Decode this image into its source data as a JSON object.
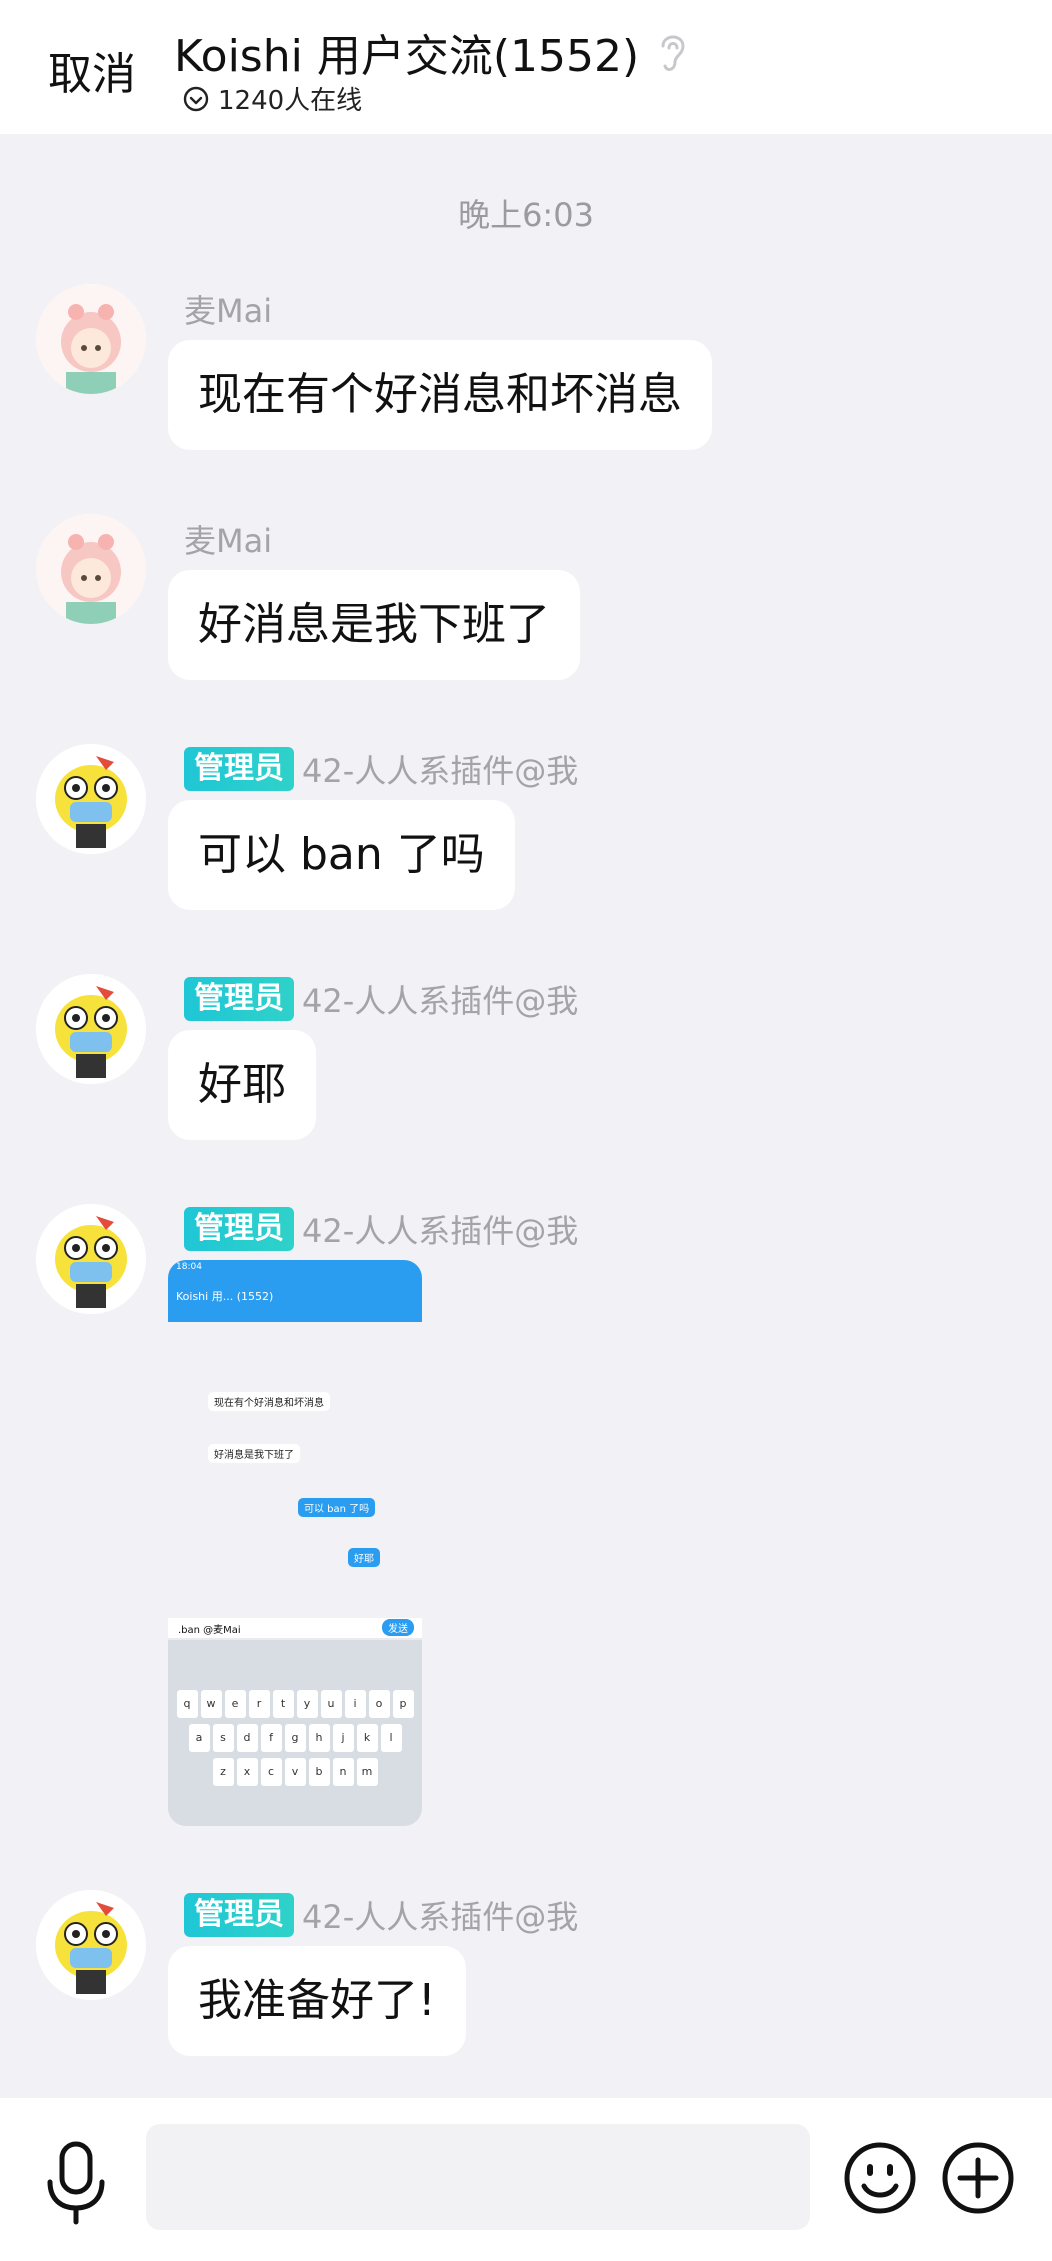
{
  "header": {
    "cancel_label": "取消",
    "title": "Koishi 用户交流(1552)",
    "online_text": "1240人在线"
  },
  "chat": {
    "timestamp": "晚上6:03",
    "messages": [
      {
        "sender": "麦Mai",
        "badge": "",
        "text": "现在有个好消息和坏消息"
      },
      {
        "sender": "麦Mai",
        "badge": "",
        "text": "好消息是我下班了"
      },
      {
        "sender": "42-人人系插件@我",
        "badge": "管理员",
        "text": "可以 ban 了吗"
      },
      {
        "sender": "42-人人系插件@我",
        "badge": "管理员",
        "text": "好耶"
      },
      {
        "sender": "42-人人系插件@我",
        "badge": "管理员",
        "text": ""
      },
      {
        "sender": "42-人人系插件@我",
        "badge": "管理员",
        "text": "我准备好了!"
      }
    ],
    "screenshot_image": {
      "status_time": "18:04",
      "title": "Koishi 用... (1552)",
      "lines": [
        "现在有个好消息和坏消息",
        "好消息是我下班了",
        "可以 ban 了吗",
        "好耶"
      ],
      "input_text": ".ban @麦Mai",
      "send_label": "发送",
      "keyboard_rows": [
        [
          "q",
          "w",
          "e",
          "r",
          "t",
          "y",
          "u",
          "i",
          "o",
          "p"
        ],
        [
          "a",
          "s",
          "d",
          "f",
          "g",
          "h",
          "j",
          "k",
          "l"
        ],
        [
          "z",
          "x",
          "c",
          "v",
          "b",
          "n",
          "m"
        ]
      ]
    }
  },
  "input": {
    "placeholder": ""
  },
  "colors": {
    "background": "#f2f1f6",
    "bubble": "#ffffff",
    "badge": "#1fc6d6",
    "name": "#a3a3a8"
  },
  "icons": [
    "ear-icon",
    "check-circle-icon",
    "mic-icon",
    "emoji-icon",
    "plus-circle-icon"
  ]
}
